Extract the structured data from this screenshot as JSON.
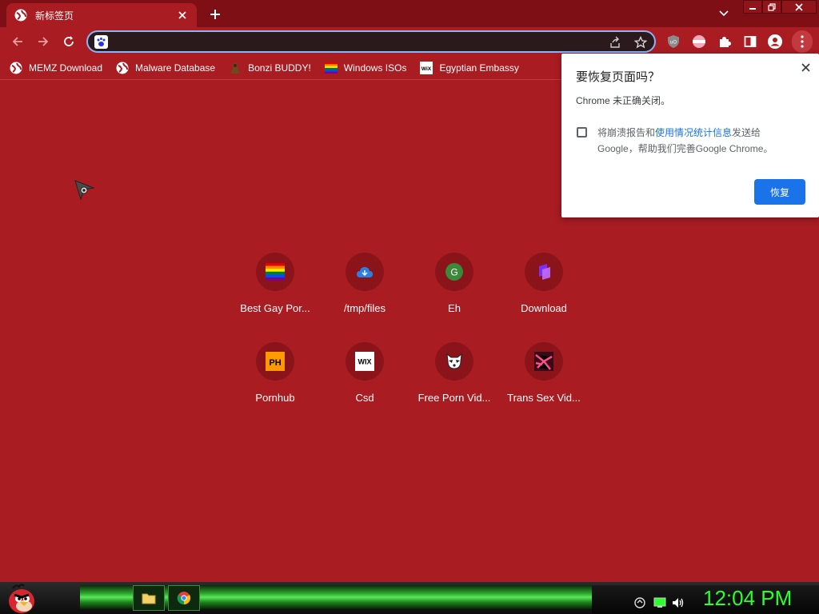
{
  "tab": {
    "title": "新标签页"
  },
  "omnibox": {
    "value": "",
    "placeholder": ""
  },
  "bookmarks": [
    {
      "label": "MEMZ Download",
      "icon": "globe-icon"
    },
    {
      "label": "Malware Database",
      "icon": "globe-icon"
    },
    {
      "label": "Bonzi BUDDY!",
      "icon": "bonzi-icon"
    },
    {
      "label": "Windows ISOs",
      "icon": "rainbow-flag-icon"
    },
    {
      "label": "Egyptian Embassy",
      "icon": "wix-icon"
    }
  ],
  "shortcuts": [
    {
      "label": "Best Gay Por...",
      "icon": "rainbow-flag-icon"
    },
    {
      "label": "/tmp/files",
      "icon": "cloud-icon"
    },
    {
      "label": "Eh",
      "icon": "g-letter-icon",
      "letter": "G"
    },
    {
      "label": "Download",
      "icon": "purple-logo-icon"
    },
    {
      "label": "Pornhub",
      "icon": "ph-icon",
      "letter": "PH"
    },
    {
      "label": "Csd",
      "icon": "wix-icon",
      "letter": "WIX"
    },
    {
      "label": "Free Porn Vid...",
      "icon": "raccoon-icon"
    },
    {
      "label": "Trans Sex Vid...",
      "icon": "pink-pattern-icon"
    }
  ],
  "dialog": {
    "title": "要恢复页面吗？",
    "message": "Chrome 未正确关闭。",
    "option_prefix": "将崩溃报告和",
    "option_link": "使用情况统计信息",
    "option_suffix": "发送给",
    "option_line2": "Google，帮助我们完善Google Chrome。",
    "button": "恢复"
  },
  "taskbar": {
    "clock": "12:04 PM"
  },
  "colors": {
    "background": "#a81c22",
    "tabstrip": "#7e0f14",
    "accent": "#1a73e8",
    "clock": "#2cff2c"
  }
}
